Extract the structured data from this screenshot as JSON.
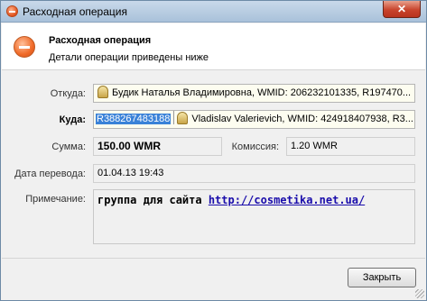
{
  "window": {
    "title": "Расходная операция",
    "close_symbol": "✕"
  },
  "header": {
    "title": "Расходная операция",
    "subtitle": "Детали операции приведены ниже"
  },
  "form": {
    "from_label": "Откуда:",
    "from_value": "Будик Наталья Владимировна, WMID: 206232101335, R197470...",
    "to_label": "Куда:",
    "to_purse": "R388267483188",
    "to_value": "Vladislav Valerievich, WMID: 424918407938, R3...",
    "amount_label": "Сумма:",
    "amount_value": "150.00 WMR",
    "commission_label": "Комиссия:",
    "commission_value": "1.20 WMR",
    "date_label": "Дата перевода:",
    "date_value": "01.04.13 19:43",
    "note_label": "Примечание:",
    "note_text": "группа для сайта",
    "note_link": "http://cosmetika.net.ua/"
  },
  "footer": {
    "close_button": "Закрыть"
  }
}
